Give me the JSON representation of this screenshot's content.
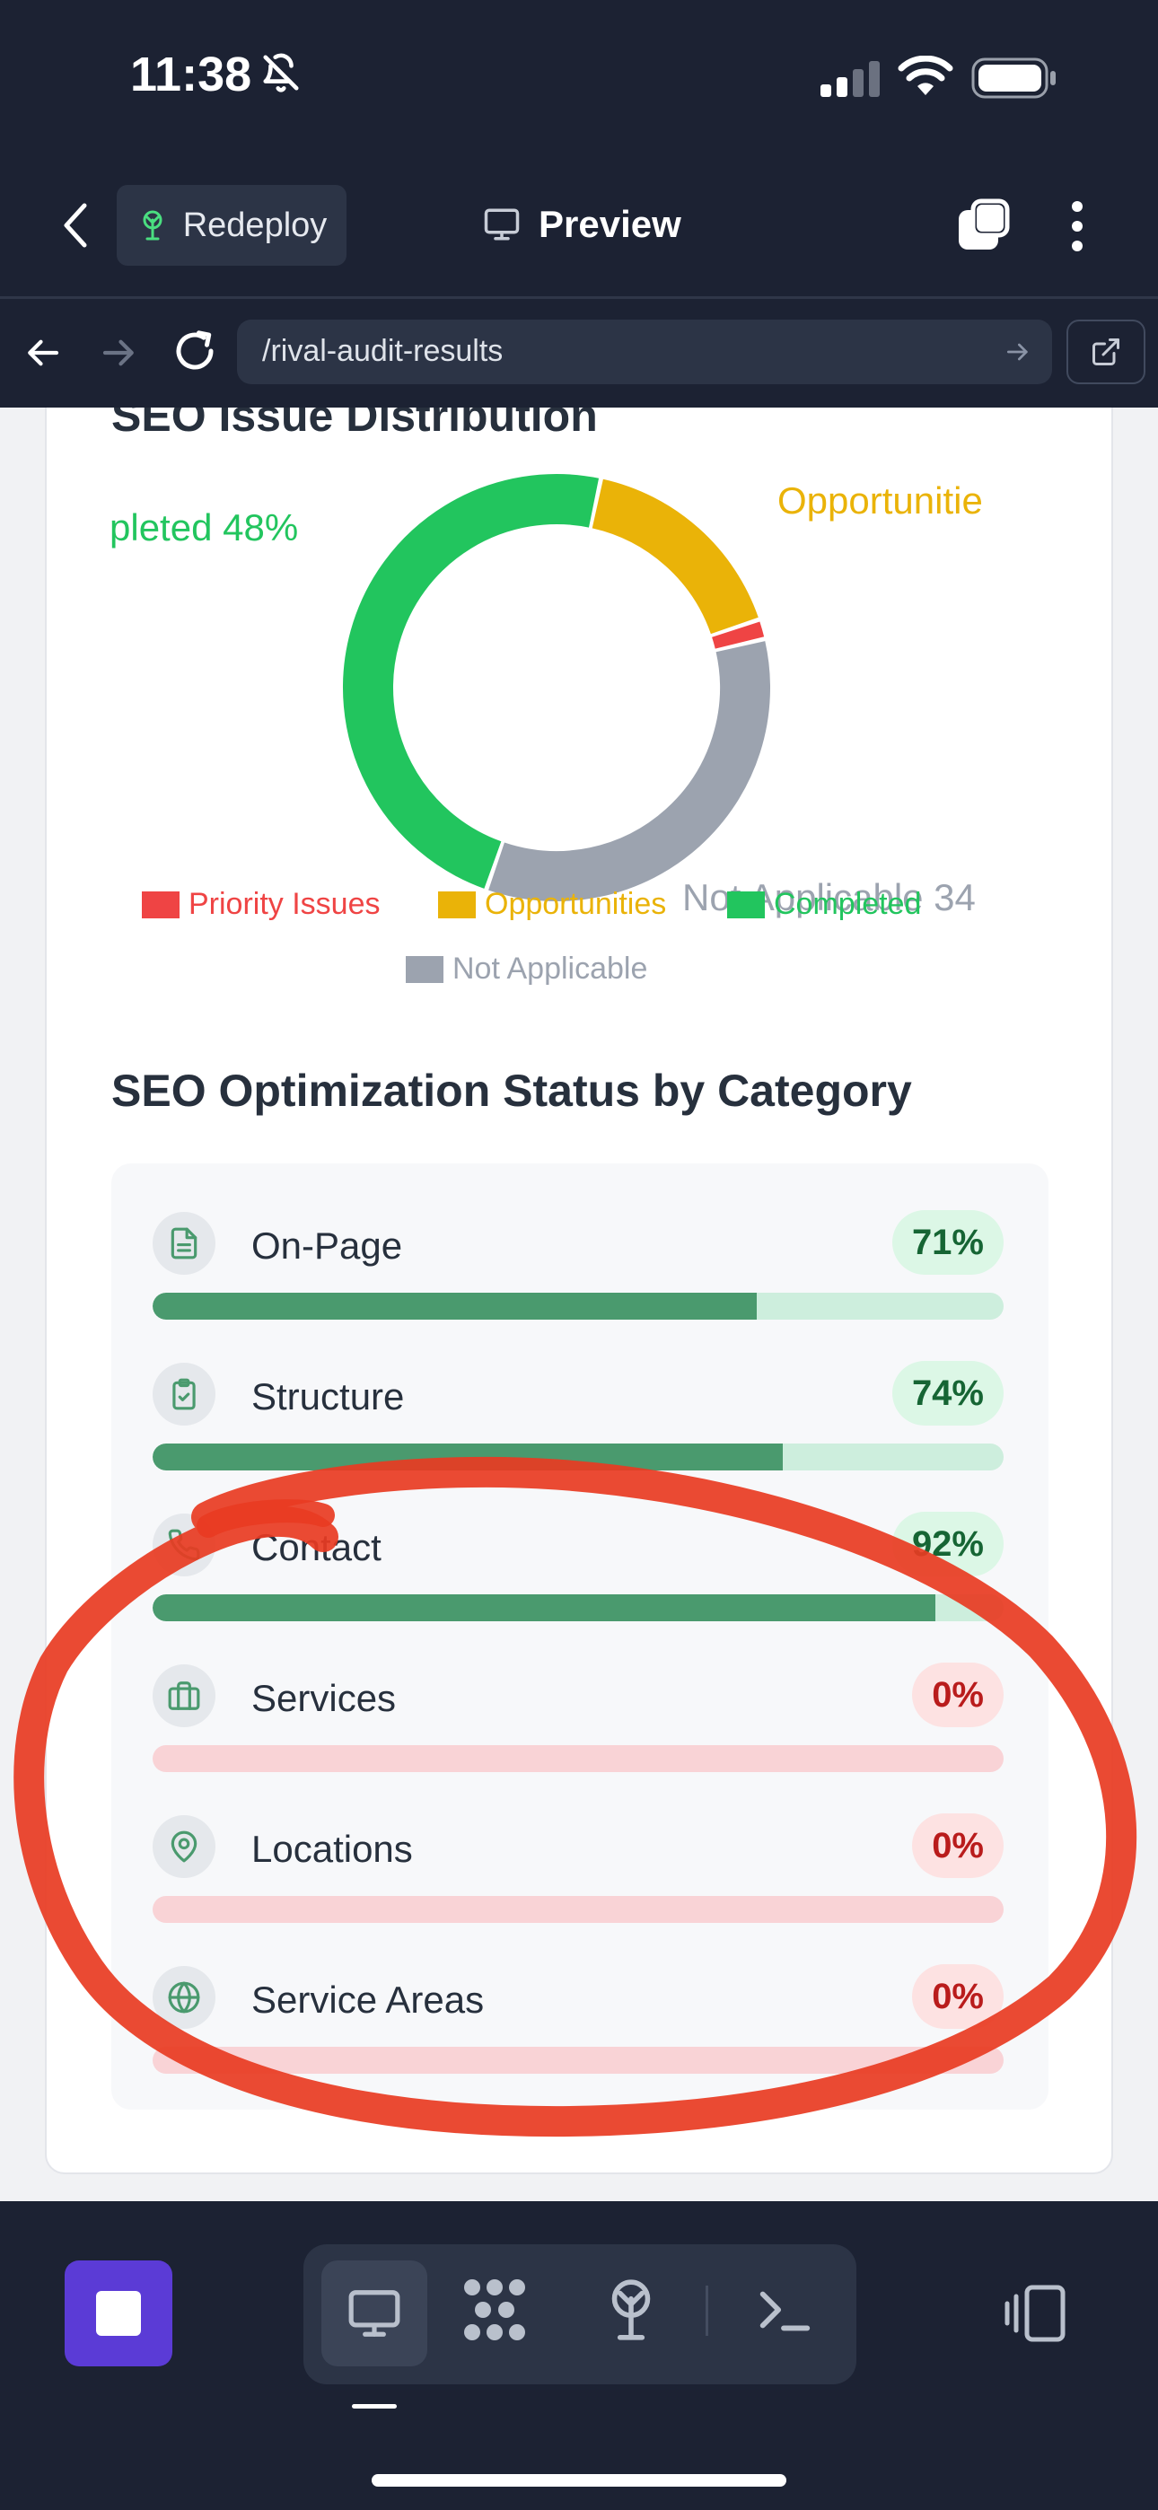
{
  "status_bar": {
    "time": "11:38"
  },
  "header": {
    "redeploy_label": "Redeploy",
    "title": "Preview"
  },
  "url_bar": {
    "path": "/rival-audit-results"
  },
  "chart_section": {
    "title": "SEO Issue Distribution"
  },
  "chart_data": {
    "type": "pie",
    "title": "SEO Issue Distribution",
    "categories": [
      "Priority Issues",
      "Opportunities",
      "Completed",
      "Not Applicable"
    ],
    "values": [
      1.5,
      16.5,
      48,
      34
    ],
    "colors": [
      "#ef4444",
      "#eab308",
      "#22c55e",
      "#9ca3af"
    ],
    "slice_labels": [
      "",
      "Opportunitie",
      "pleted 48%",
      "Not Applicable 34"
    ],
    "legend": [
      "Priority Issues",
      "Opportunities",
      "Completed",
      "Not Applicable"
    ],
    "legend_position": "bottom"
  },
  "categories_section": {
    "title": "SEO Optimization Status by Category",
    "items": [
      {
        "name": "On-Page",
        "percent_label": "71%",
        "percent": 71,
        "status": "good",
        "icon": "document-icon"
      },
      {
        "name": "Structure",
        "percent_label": "74%",
        "percent": 74,
        "status": "good",
        "icon": "clipboard-check-icon"
      },
      {
        "name": "Contact",
        "percent_label": "92%",
        "percent": 92,
        "status": "good",
        "icon": "phone-icon"
      },
      {
        "name": "Services",
        "percent_label": "0%",
        "percent": 0,
        "status": "bad",
        "icon": "briefcase-icon"
      },
      {
        "name": "Locations",
        "percent_label": "0%",
        "percent": 0,
        "status": "bad",
        "icon": "map-pin-icon"
      },
      {
        "name": "Service Areas",
        "percent_label": "0%",
        "percent": 0,
        "status": "bad",
        "icon": "globe-icon"
      }
    ]
  },
  "colors": {
    "annotation": "#e83b22",
    "progress_fill": "#4a9a6e",
    "accent": "#5b3bd6"
  }
}
